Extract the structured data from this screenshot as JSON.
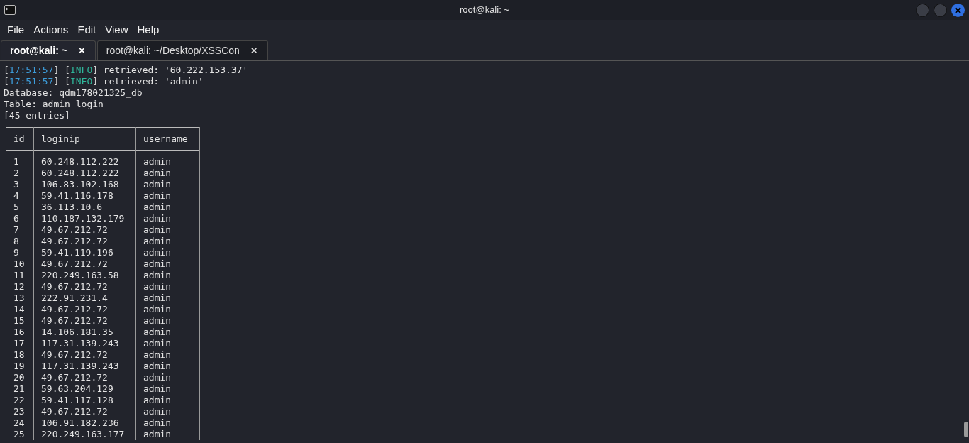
{
  "window": {
    "title": "root@kali: ~"
  },
  "menu": [
    "File",
    "Actions",
    "Edit",
    "View",
    "Help"
  ],
  "tabs": [
    {
      "label": "root@kali: ~",
      "close": "×",
      "selected": true
    },
    {
      "label": "root@kali: ~/Desktop/XSSCon",
      "close": "×",
      "selected": false
    }
  ],
  "log": [
    {
      "segments": [
        {
          "kind": "bracket",
          "text": "["
        },
        {
          "kind": "time",
          "text": "17:51:57"
        },
        {
          "kind": "bracket",
          "text": "]"
        },
        {
          "kind": "bracket",
          "text": "["
        },
        {
          "kind": "level",
          "text": "INFO"
        },
        {
          "kind": "bracket",
          "text": "]"
        },
        {
          "kind": "message",
          "text": "retrieved: '60.222.153.37'"
        }
      ]
    },
    {
      "segments": [
        {
          "kind": "bracket",
          "text": "["
        },
        {
          "kind": "time",
          "text": "17:51:57"
        },
        {
          "kind": "bracket",
          "text": "]"
        },
        {
          "kind": "bracket",
          "text": "["
        },
        {
          "kind": "level",
          "text": "INFO"
        },
        {
          "kind": "bracket",
          "text": "]"
        },
        {
          "kind": "message",
          "text": "retrieved: 'admin'"
        }
      ]
    }
  ],
  "info_lines": [
    "Database: qdm178021325_db",
    "Table: admin_login",
    "[45 entries]"
  ],
  "table": {
    "columns": [
      "id",
      "loginip",
      "username"
    ],
    "rows": [
      [
        "1",
        "60.248.112.222",
        "admin"
      ],
      [
        "2",
        "60.248.112.222",
        "admin"
      ],
      [
        "3",
        "106.83.102.168",
        "admin"
      ],
      [
        "4",
        "59.41.116.178",
        "admin"
      ],
      [
        "5",
        "36.113.10.6",
        "admin"
      ],
      [
        "6",
        "110.187.132.179",
        "admin"
      ],
      [
        "7",
        "49.67.212.72",
        "admin"
      ],
      [
        "8",
        "49.67.212.72",
        "admin"
      ],
      [
        "9",
        "59.41.119.196",
        "admin"
      ],
      [
        "10",
        "49.67.212.72",
        "admin"
      ],
      [
        "11",
        "220.249.163.58",
        "admin"
      ],
      [
        "12",
        "49.67.212.72",
        "admin"
      ],
      [
        "13",
        "222.91.231.4",
        "admin"
      ],
      [
        "14",
        "49.67.212.72",
        "admin"
      ],
      [
        "15",
        "49.67.212.72",
        "admin"
      ],
      [
        "16",
        "14.106.181.35",
        "admin"
      ],
      [
        "17",
        "117.31.139.243",
        "admin"
      ],
      [
        "18",
        "49.67.212.72",
        "admin"
      ],
      [
        "19",
        "117.31.139.243",
        "admin"
      ],
      [
        "20",
        "49.67.212.72",
        "admin"
      ],
      [
        "21",
        "59.63.204.129",
        "admin"
      ],
      [
        "22",
        "59.41.117.128",
        "admin"
      ],
      [
        "23",
        "49.67.212.72",
        "admin"
      ],
      [
        "24",
        "106.91.182.236",
        "admin"
      ],
      [
        "25",
        "220.249.163.177",
        "admin"
      ]
    ]
  }
}
